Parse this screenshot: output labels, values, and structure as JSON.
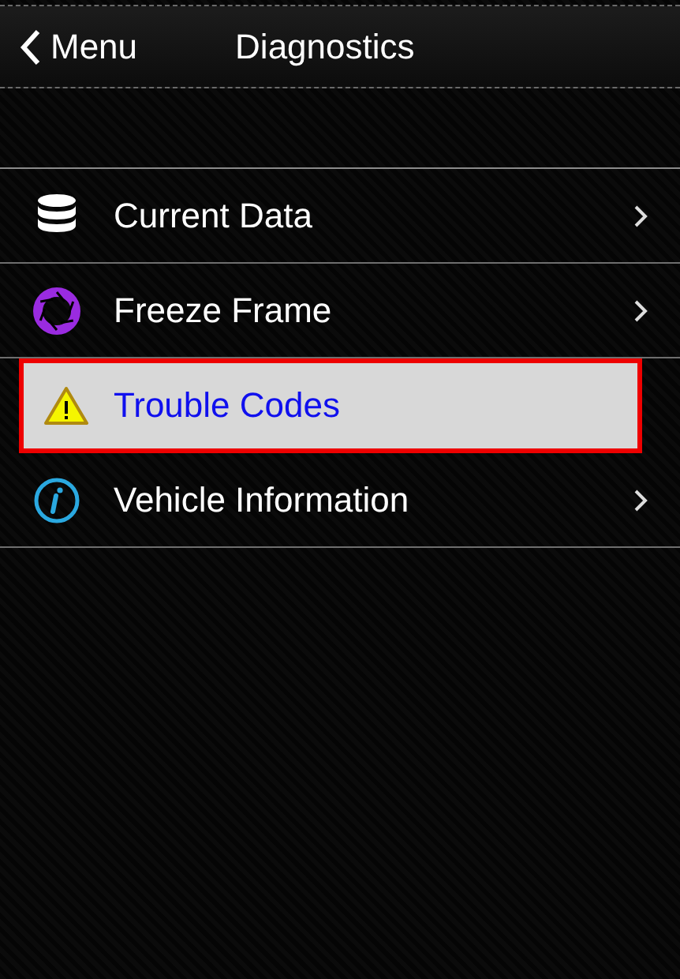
{
  "nav_bar": {
    "back_label": "Menu",
    "title": "Diagnostics"
  },
  "menu_items": [
    {
      "label": "Current Data",
      "kind": "database",
      "selected": false
    },
    {
      "label": "Freeze Frame",
      "kind": "aperture",
      "selected": false
    },
    {
      "label": "Trouble Codes",
      "kind": "warning",
      "selected": true
    },
    {
      "label": "Vehicle Information",
      "kind": "info",
      "selected": false
    }
  ]
}
